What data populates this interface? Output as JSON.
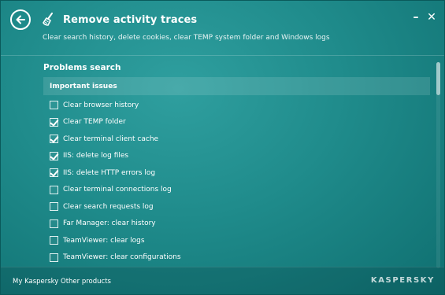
{
  "header": {
    "title": "Remove activity traces",
    "subtitle": "Clear search history, delete cookies, clear TEMP system folder and Windows logs",
    "back_icon": "arrow-left-icon",
    "app_icon": "broom-icon",
    "minimize_glyph": "–",
    "close_glyph": "✕"
  },
  "content": {
    "section_title": "Problems search",
    "group_header": "Important issues",
    "items": [
      {
        "label": "Clear browser history",
        "checked": false
      },
      {
        "label": "Clear TEMP folder",
        "checked": true
      },
      {
        "label": "Clear terminal client cache",
        "checked": true
      },
      {
        "label": "IIS: delete log files",
        "checked": true
      },
      {
        "label": "IIS: delete HTTP errors log",
        "checked": true
      },
      {
        "label": "Clear terminal connections log",
        "checked": false
      },
      {
        "label": "Clear search requests log",
        "checked": false
      },
      {
        "label": "Far Manager: clear history",
        "checked": false
      },
      {
        "label": "TeamViewer: clear logs",
        "checked": false
      },
      {
        "label": "TeamViewer: clear configurations",
        "checked": false
      }
    ]
  },
  "footer": {
    "my_kaspersky": "My Kaspersky",
    "other_products": "Other products",
    "brand": "KASPERSKY"
  },
  "colors": {
    "background_primary": "#1f8b8b",
    "background_dark": "#0f6f70",
    "text": "#ffffff"
  }
}
